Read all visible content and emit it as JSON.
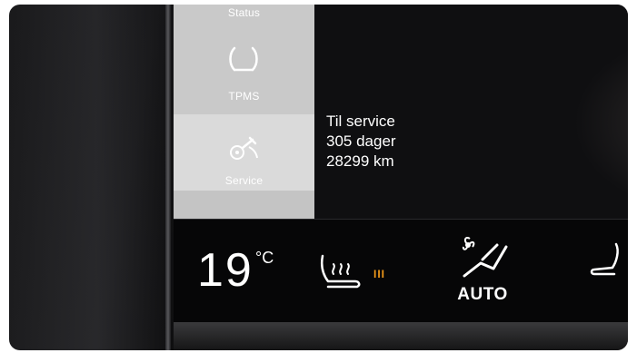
{
  "sidebar": {
    "items": [
      {
        "label": "Status",
        "icon": "status-icon"
      },
      {
        "label": "TPMS",
        "icon": "tire-pressure-icon"
      },
      {
        "label": "Service",
        "icon": "service-wrench-icon",
        "selected": true
      }
    ]
  },
  "service_info": {
    "title": "Til service",
    "days": "305 dager",
    "distance": "28299 km"
  },
  "climate": {
    "temperature": "19",
    "unit": "°C",
    "seat_heat_level": "III",
    "auto_label": "AUTO"
  },
  "colors": {
    "sidebar_bg": "#c9c9c9",
    "screen_bg": "#0f0f11",
    "heat_accent": "#f29a1a",
    "text": "#ffffff"
  }
}
